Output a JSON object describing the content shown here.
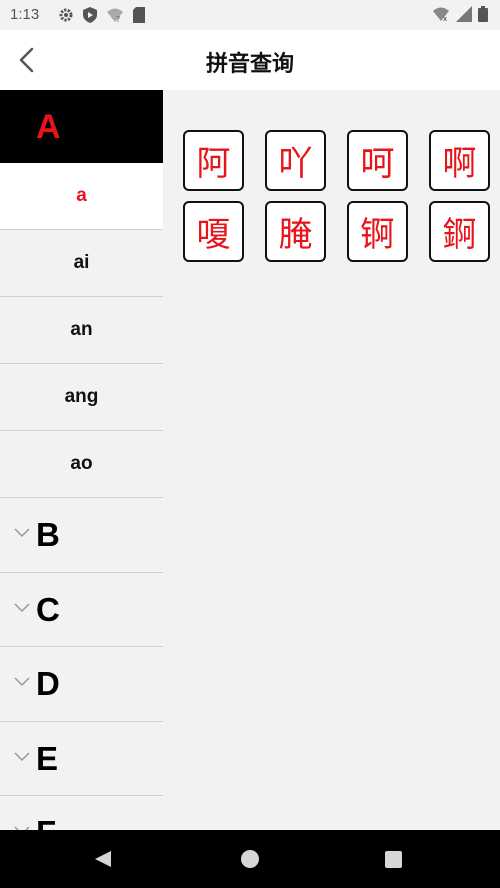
{
  "status_bar": {
    "time": "1:13",
    "left_icons": [
      "gear-icon",
      "shield-icon",
      "wifi-question-icon",
      "sd-card-icon"
    ],
    "right_icons": [
      "wifi-icon",
      "signal-icon",
      "battery-icon"
    ]
  },
  "header": {
    "title": "拼音查询",
    "back_icon": "chevron-left-icon"
  },
  "sidebar": {
    "active_group": {
      "letter": "A",
      "items": [
        {
          "label": "a",
          "selected": true
        },
        {
          "label": "ai",
          "selected": false
        },
        {
          "label": "an",
          "selected": false
        },
        {
          "label": "ang",
          "selected": false
        },
        {
          "label": "ao",
          "selected": false
        }
      ]
    },
    "collapsed_groups": [
      "B",
      "C",
      "D",
      "E",
      "F"
    ]
  },
  "content": {
    "characters": [
      "阿",
      "吖",
      "呵",
      "啊",
      "嗄",
      "腌",
      "锕",
      "錒"
    ]
  },
  "colors": {
    "accent": "#e8141b",
    "active_header_bg": "#000000",
    "background": "#f2f2f2"
  },
  "nav_bar": {
    "buttons": [
      "back-triangle-icon",
      "home-circle-icon",
      "recents-square-icon"
    ]
  }
}
